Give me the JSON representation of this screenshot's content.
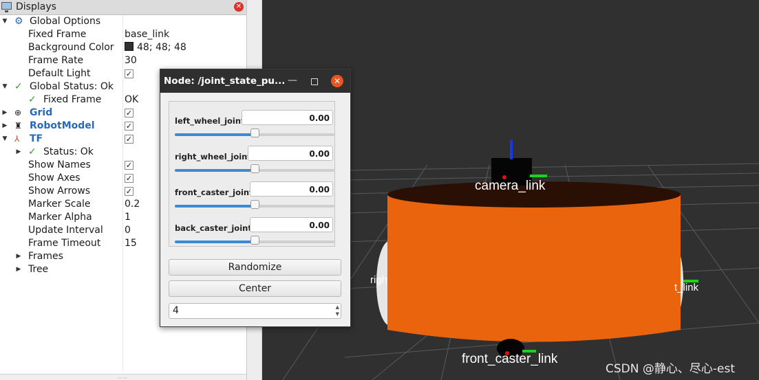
{
  "displays": {
    "title": "Displays",
    "rows": [
      {
        "label": "Global Options",
        "value": ""
      },
      {
        "label": "Fixed Frame",
        "value": "base_link"
      },
      {
        "label": "Background Color",
        "value": "48; 48; 48"
      },
      {
        "label": "Frame Rate",
        "value": "30"
      },
      {
        "label": "Default Light",
        "value": ""
      },
      {
        "label": "Global Status: Ok",
        "value": ""
      },
      {
        "label": "Fixed Frame",
        "value": "OK"
      },
      {
        "label": "Grid",
        "value": ""
      },
      {
        "label": "RobotModel",
        "value": ""
      },
      {
        "label": "TF",
        "value": ""
      },
      {
        "label": "Status: Ok",
        "value": ""
      },
      {
        "label": "Show Names",
        "value": ""
      },
      {
        "label": "Show Axes",
        "value": ""
      },
      {
        "label": "Show Arrows",
        "value": ""
      },
      {
        "label": "Marker Scale",
        "value": "0.2"
      },
      {
        "label": "Marker Alpha",
        "value": "1"
      },
      {
        "label": "Update Interval",
        "value": "0"
      },
      {
        "label": "Frame Timeout",
        "value": "15"
      },
      {
        "label": "Frames",
        "value": ""
      },
      {
        "label": "Tree",
        "value": ""
      }
    ],
    "background_color_hex": "#303030"
  },
  "node_window": {
    "title": "Node: /joint_state_pu...",
    "joints": [
      {
        "name": "left_wheel_joint",
        "value": "0.00",
        "position": 0.5
      },
      {
        "name": "right_wheel_joint",
        "value": "0.00",
        "position": 0.5
      },
      {
        "name": "front_caster_joint",
        "value": "0.00",
        "position": 0.5
      },
      {
        "name": "back_caster_joint",
        "value": "0.00",
        "position": 0.5
      }
    ],
    "randomize_label": "Randomize",
    "center_label": "Center",
    "spin_value": "4"
  },
  "viewport": {
    "labels": {
      "camera": "camera_link",
      "front_caster": "front_caster_link",
      "right_wheel_partial": "righ",
      "left_wheel_partial": "t_link"
    },
    "body_color": "#e9640d",
    "watermark": "CSDN @静心、尽心-est"
  }
}
